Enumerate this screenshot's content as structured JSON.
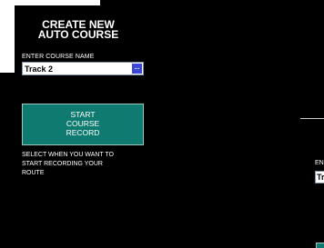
{
  "title": "CREATE NEW\nAUTO COURSE",
  "field_label": "ENTER COURSE NAME",
  "course_name_value": "Track 2",
  "ellipsis_label": "...",
  "start_button_label": "START\nCOURSE\nRECORD",
  "help_text": "SELECT WHEN YOU WANT TO\nSTART RECORDING YOUR\nROUTE",
  "right_panel": {
    "label_fragment": "EN",
    "input_fragment": "Tr"
  }
}
